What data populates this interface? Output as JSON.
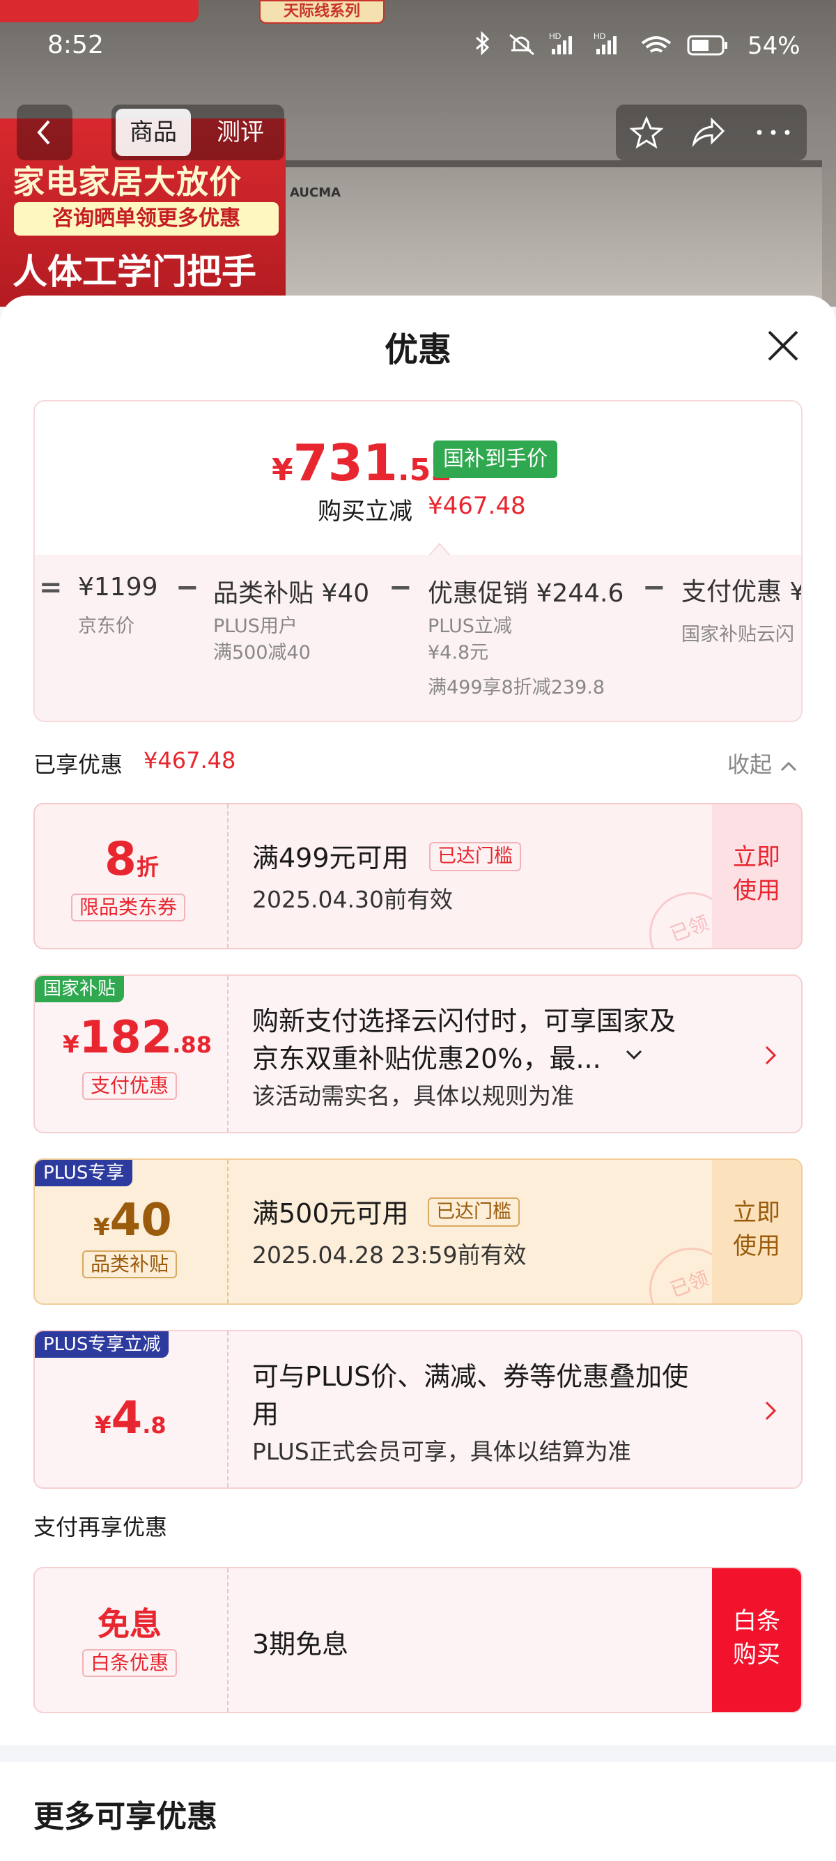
{
  "status_bar": {
    "time": "8:52",
    "battery": "54%"
  },
  "background": {
    "brand_tag": "天际线系列",
    "promo_line1": "家电家居大放价",
    "promo_line2": "咨询晒单领更多优惠",
    "promo_line3": "人体工学门把手",
    "brand_logo": "AUCMA"
  },
  "nav": {
    "tabs": [
      "商品",
      "测评"
    ]
  },
  "sheet": {
    "title": "优惠"
  },
  "summary": {
    "price_currency": "¥",
    "price_int": "731",
    "price_dec": ".52",
    "badge": "国补到手价",
    "reduce_label": "购买立减",
    "reduce_value": "¥467.48",
    "breakdown": [
      {
        "op": "=",
        "main": "¥1199",
        "subs": [
          "京东价"
        ]
      },
      {
        "op": "−",
        "main": "品类补贴 ¥40",
        "subs": [
          "PLUS用户",
          "满500减40"
        ]
      },
      {
        "op": "−",
        "main": "优惠促销 ¥244.6",
        "subs": [
          "PLUS立减",
          "¥4.8元",
          "满499享8折减239.8"
        ]
      },
      {
        "op": "−",
        "main": "支付优惠 ¥",
        "subs": [
          "国家补贴云闪"
        ]
      }
    ]
  },
  "enjoyed": {
    "label": "已享优惠",
    "value": "¥467.48",
    "collapse": "收起"
  },
  "cards": {
    "c1": {
      "value": "8",
      "unit": "折",
      "type": "限品类东券",
      "title": "满499元可用",
      "reach": "已达门槛",
      "sub": "2025.04.30前有效",
      "action": [
        "立即",
        "使用"
      ],
      "stamp": "已领"
    },
    "c2": {
      "tag": "国家补贴",
      "cur": "¥",
      "int": "182",
      "dec": ".88",
      "type": "支付优惠",
      "line1": "购新支付选择云闪付时，可享国家及",
      "line2": "京东双重补贴优惠20%，最...",
      "line3": "该活动需实名，具体以规则为准"
    },
    "c3": {
      "tag": "PLUS专享",
      "cur": "¥",
      "int": "40",
      "type": "品类补贴",
      "title": "满500元可用",
      "reach": "已达门槛",
      "sub": "2025.04.28 23:59前有效",
      "action": [
        "立即",
        "使用"
      ],
      "stamp": "已领"
    },
    "c4": {
      "tag": "PLUS专享立减",
      "cur": "¥",
      "int": "4",
      "dec": ".8",
      "line1": "可与PLUS价、满减、券等优惠叠加使",
      "line2": "用",
      "line3": "PLUS正式会员可享，具体以结算为准"
    }
  },
  "pay_again": {
    "label": "支付再享优惠"
  },
  "installment": {
    "value": "免息",
    "type": "白条优惠",
    "title": "3期免息",
    "action": [
      "白条",
      "购买"
    ]
  },
  "more": {
    "title": "更多可享优惠"
  },
  "colors": {
    "red": "#e8262f",
    "green": "#2fa84f",
    "plus_blue": "#2d3a9e",
    "gold": "#9a5b0c"
  }
}
